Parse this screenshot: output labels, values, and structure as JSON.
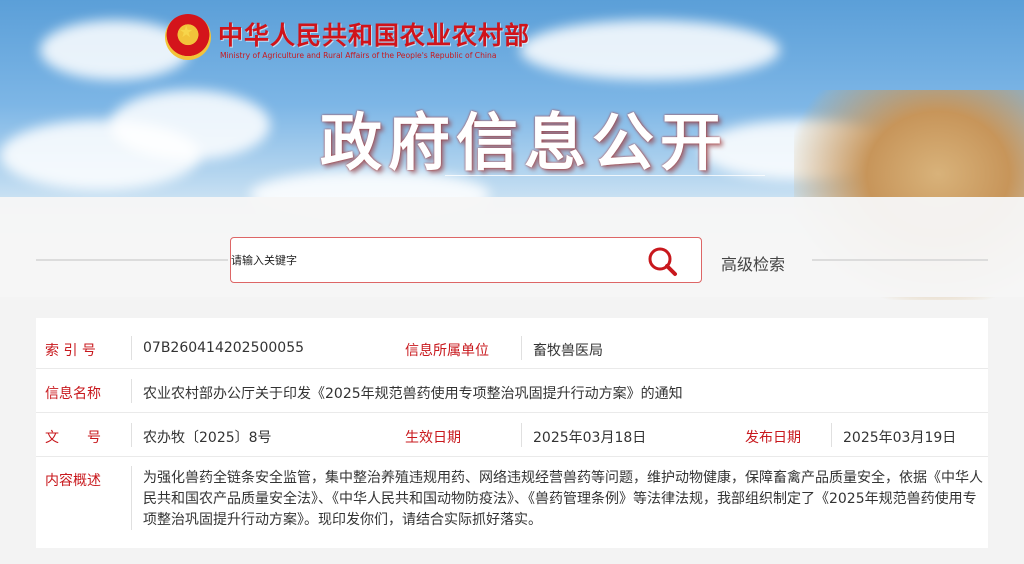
{
  "header": {
    "ministry_cn": "中华人民共和国农业农村部",
    "ministry_en": "Ministry of Agriculture and Rural Affairs of the People's Republic of China",
    "title": "政府信息公开"
  },
  "search": {
    "placeholder": "请输入关键字",
    "advanced_label": "高级检索"
  },
  "info": {
    "index_label": "索 引 号",
    "index_value": "07B260414202500055",
    "unit_label": "信息所属单位",
    "unit_value": "畜牧兽医局",
    "name_label": "信息名称",
    "name_value": "农业农村部办公厅关于印发《2025年规范兽药使用专项整治巩固提升行动方案》的通知",
    "doc_label": "文　　号",
    "doc_value": "农办牧〔2025〕8号",
    "effective_label": "生效日期",
    "effective_value": "2025年03月18日",
    "publish_label": "发布日期",
    "publish_value": "2025年03月19日",
    "summary_label": "内容概述",
    "summary_value": "为强化兽药全链条安全监管，集中整治养殖违规用药、网络违规经营兽药等问题，维护动物健康，保障畜禽产品质量安全，依据《中华人民共和国农产品质量安全法》、《中华人民共和国动物防疫法》、《兽药管理条例》等法律法规，我部组织制定了《2025年规范兽药使用专项整治巩固提升行动方案》。现印发你们，请结合实际抓好落实。"
  },
  "colors": {
    "accent_red": "#c8181d",
    "search_border": "#d66666"
  }
}
